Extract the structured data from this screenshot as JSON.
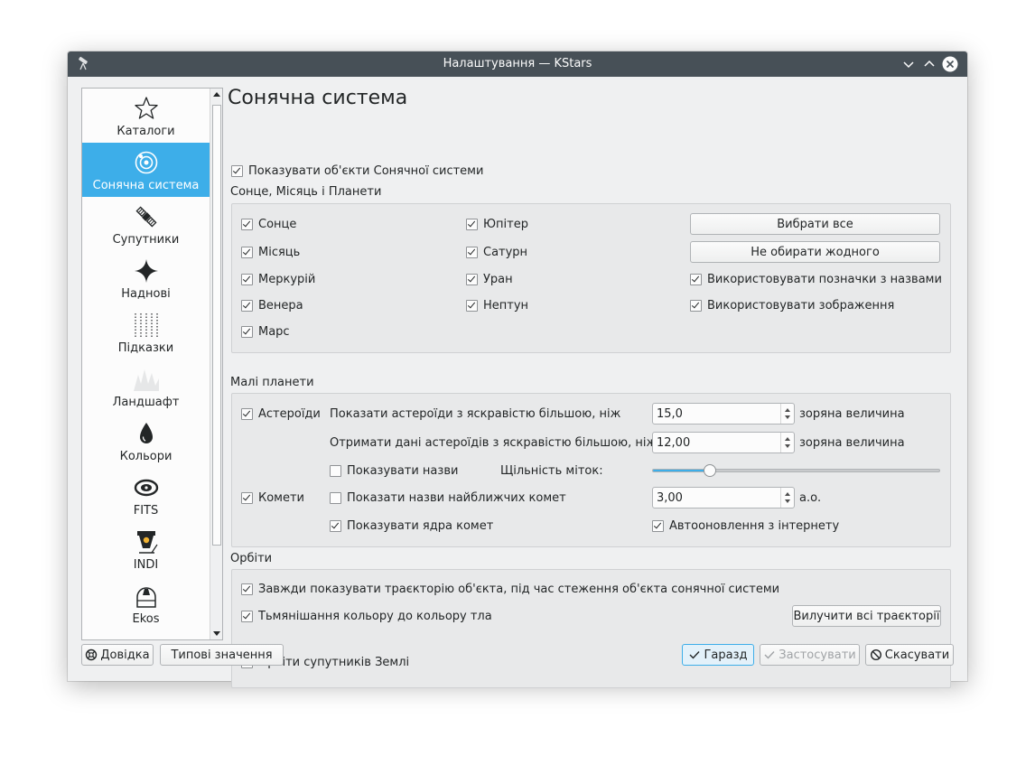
{
  "window": {
    "title": "Налаштування — KStars"
  },
  "sidebar": {
    "items": [
      {
        "label": "Каталоги",
        "icon": "star-outline-icon"
      },
      {
        "label": "Сонячна система",
        "icon": "solar-system-icon",
        "active": true
      },
      {
        "label": "Супутники",
        "icon": "satellite-icon"
      },
      {
        "label": "Наднові",
        "icon": "supernova-icon"
      },
      {
        "label": "Підказки",
        "icon": "guides-grid-icon"
      },
      {
        "label": "Ландшафт",
        "icon": "landscape-icon"
      },
      {
        "label": "Кольори",
        "icon": "color-drop-icon"
      },
      {
        "label": "FITS",
        "icon": "galaxy-icon"
      },
      {
        "label": "INDI",
        "icon": "indi-telescope-icon"
      },
      {
        "label": "Ekos",
        "icon": "observatory-dome-icon"
      }
    ]
  },
  "page": {
    "title": "Сонячна система",
    "show_solar_system": "Показувати об'єкти Сонячної системи",
    "planets_group": {
      "label": "Сонце, Місяць і Планети",
      "col1": [
        "Сонце",
        "Місяць",
        "Меркурій",
        "Венера",
        "Марс"
      ],
      "col2": [
        "Юпітер",
        "Сатурн",
        "Уран",
        "Нептун"
      ],
      "select_all": "Вибрати все",
      "select_none": "Не обирати жодного",
      "use_labels": "Використовувати позначки з назвами",
      "use_images": "Використовувати зображення"
    },
    "minor_group": {
      "label": "Малі планети",
      "asteroids": "Астероїди",
      "show_asteroids_brighter": "Показати астероїди з яскравістю більшою, ніж",
      "asteroids_mag": "15,0",
      "unit_mag": "зоряна величина",
      "download_asteroids_brighter": "Отримати дані астероїдів з яскравістю більшою, ніж",
      "download_mag": "12,00",
      "show_names": "Показувати назви",
      "label_density": "Щільність міток:",
      "label_density_value": 0.2,
      "comets": "Комети",
      "show_nearest_comet_names": "Показати назви найближчих комет",
      "comet_distance": "3,00",
      "unit_au": "а.о.",
      "show_comet_nuclei": "Показувати ядра комет",
      "auto_update": "Автооновлення з інтернету"
    },
    "orbits_group": {
      "label": "Орбіти",
      "always_show_trail": "Завжди показувати траєкторію об'єкта, під час стеження об'єкта сонячної системи",
      "fade_trail": "Тьмянішання кольору до кольору тла",
      "clear_trails": "Вилучити всі траєкторії",
      "earth_satellite_orbits": "Орбіти супутників Землі"
    }
  },
  "footer": {
    "help": "Довідка",
    "defaults": "Типові значення",
    "ok": "Гаразд",
    "apply": "Застосувати",
    "cancel": "Скасувати"
  },
  "colors": {
    "accent": "#3daee9",
    "titlebar": "#475057",
    "window_bg": "#eff0f1"
  }
}
